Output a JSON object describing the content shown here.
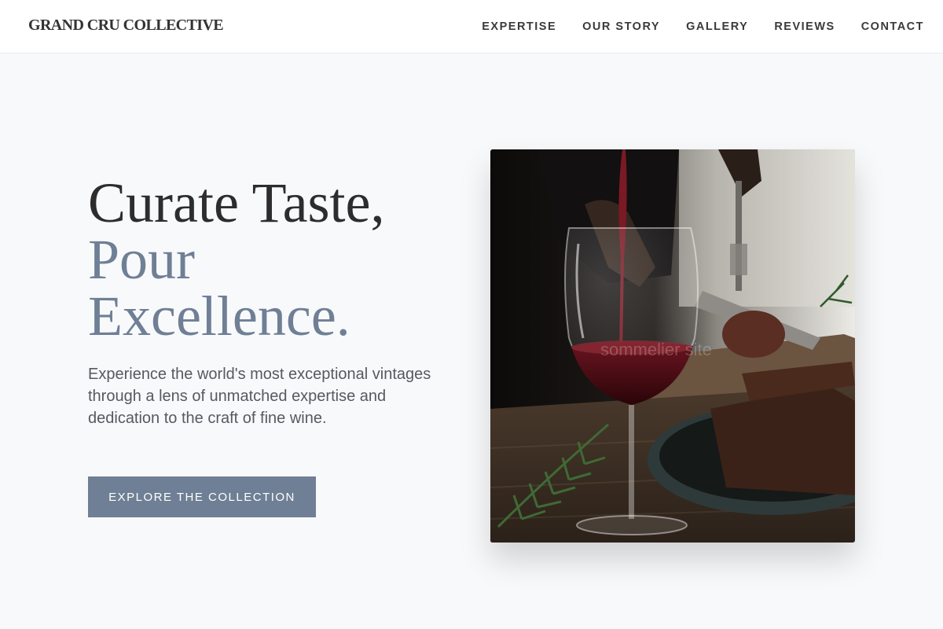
{
  "header": {
    "logo": "GRAND CRU COLLECTIVE",
    "nav": [
      {
        "label": "EXPERTISE"
      },
      {
        "label": "OUR STORY"
      },
      {
        "label": "GALLERY"
      },
      {
        "label": "REVIEWS"
      },
      {
        "label": "CONTACT"
      }
    ]
  },
  "hero": {
    "title_line1": "Curate Taste,",
    "title_line2": "Pour",
    "title_line3": "Excellence.",
    "subtitle": "Experience the world's most exceptional vintages through a lens of unmatched expertise and dedication to the craft of fine wine.",
    "cta_label": "EXPLORE THE COLLECTION",
    "image_watermark": "sommelier site"
  },
  "colors": {
    "accent": "#6f7f95",
    "heading": "#2d2d2d",
    "background": "#f8f9fb",
    "header_bg": "#ffffff"
  }
}
